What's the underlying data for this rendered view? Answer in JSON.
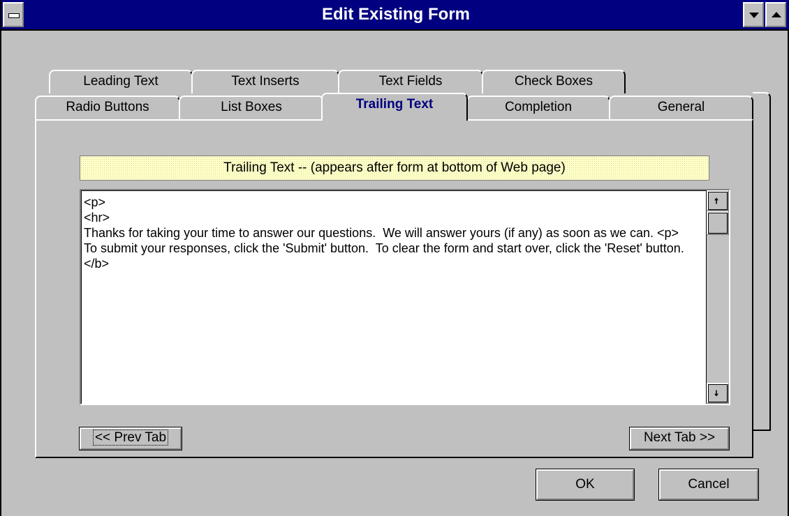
{
  "window": {
    "title": "Edit Existing Form",
    "system_menu_icon": "system-menu-icon",
    "minimize_icon": "down-arrow-icon",
    "maximize_icon": "up-arrow-icon",
    "title_bar_color": "#000080"
  },
  "tabs": {
    "back_row": [
      {
        "label": "Leading Text"
      },
      {
        "label": "Text Inserts"
      },
      {
        "label": "Text Fields"
      },
      {
        "label": "Check Boxes"
      }
    ],
    "front_row": [
      {
        "label": "Radio Buttons"
      },
      {
        "label": "List Boxes"
      },
      {
        "label": "Trailing Text",
        "active": true
      },
      {
        "label": "Completion"
      },
      {
        "label": "General"
      }
    ],
    "active_color": "#000080"
  },
  "panel": {
    "heading": "Trailing Text -- (appears after form at bottom of Web page)",
    "editor_text": "<p>\n<hr>\nThanks for taking your time to answer our questions.  We will answer yours (if any) as soon as we can. <p>\nTo submit your responses, click the 'Submit' button.  To clear the form and start over, click the 'Reset' button.\n</b>",
    "prev_label": "<< Prev Tab",
    "next_label": "Next Tab >>"
  },
  "buttons": {
    "ok": "OK",
    "cancel": "Cancel"
  }
}
